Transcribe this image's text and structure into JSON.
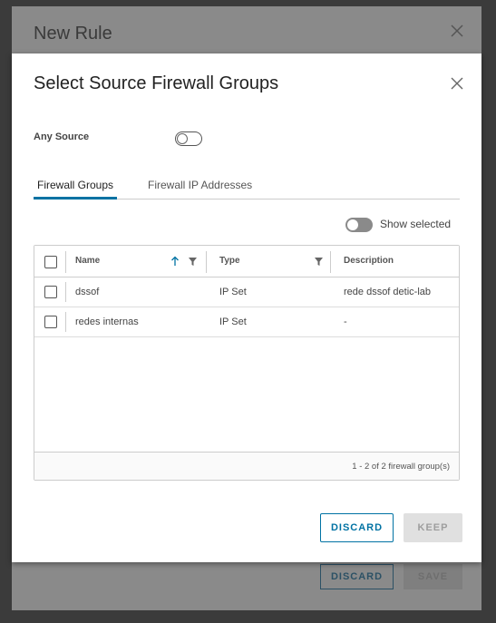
{
  "background_dialog": {
    "title": "New Rule",
    "discard_label": "DISCARD",
    "save_label": "SAVE"
  },
  "modal": {
    "title": "Select Source Firewall Groups",
    "any_source": {
      "label": "Any Source",
      "enabled": false
    },
    "tabs": [
      {
        "label": "Firewall Groups",
        "active": true
      },
      {
        "label": "Firewall IP Addresses",
        "active": false
      }
    ],
    "show_selected": {
      "label": "Show selected",
      "enabled": false
    },
    "grid": {
      "columns": {
        "name": "Name",
        "type": "Type",
        "description": "Description"
      },
      "rows": [
        {
          "name": "dssof",
          "type": "IP Set",
          "description": "rede dssof detic-lab",
          "checked": false
        },
        {
          "name": "redes internas",
          "type": "IP Set",
          "description": "-",
          "checked": false
        }
      ],
      "footer": "1 - 2 of 2 firewall group(s)"
    },
    "buttons": {
      "discard": "DISCARD",
      "keep": "KEEP"
    }
  },
  "colors": {
    "accent": "#0072a3",
    "overlay": "#3b3b3b"
  },
  "icons": [
    "close-icon",
    "sort-ascending-icon",
    "filter-icon"
  ]
}
